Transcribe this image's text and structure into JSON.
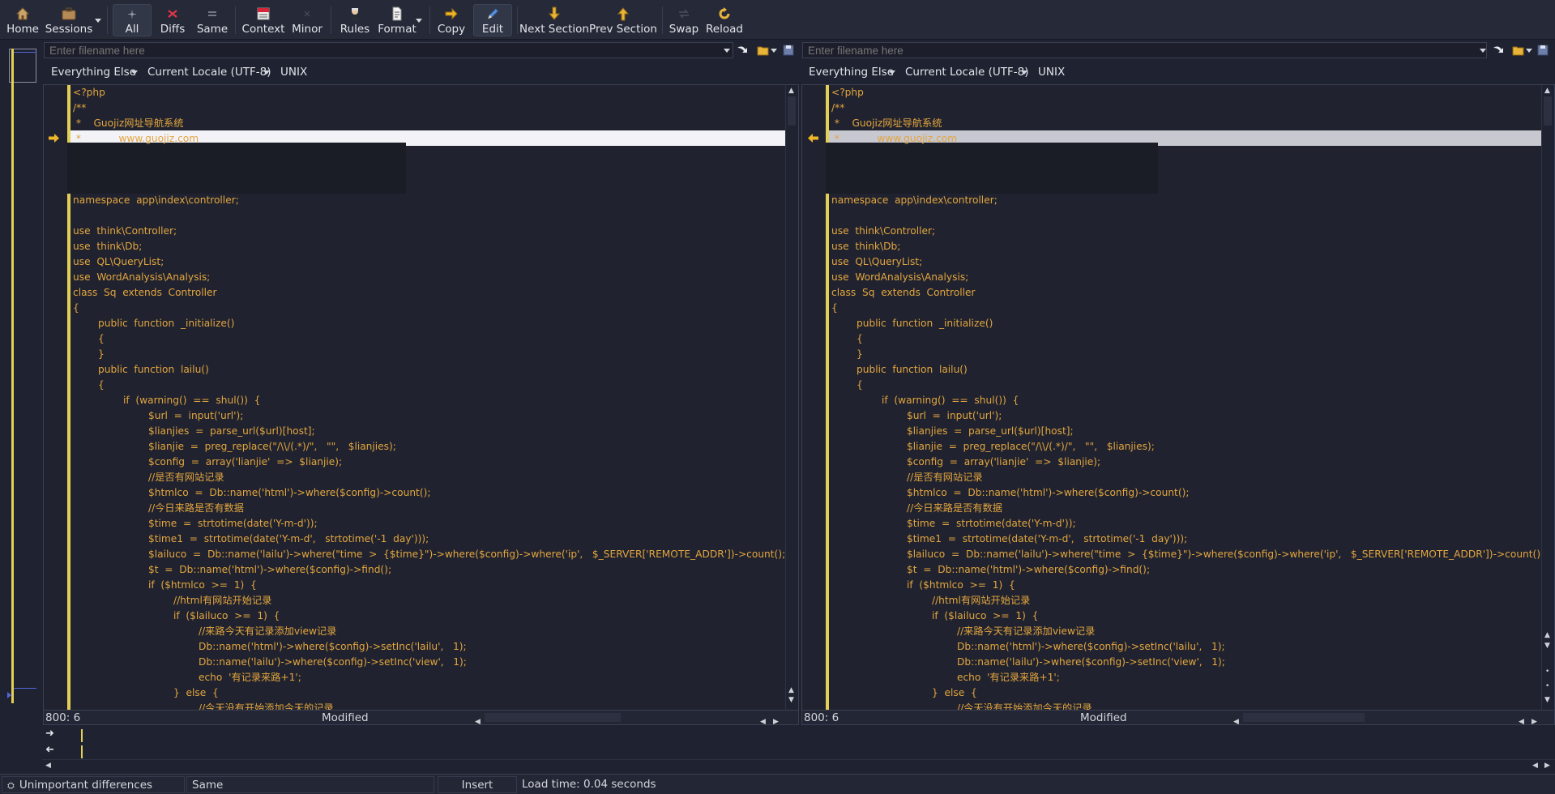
{
  "colors": {
    "background": "#1f2230",
    "code_text": "#e3a53f",
    "diff_marker": "#e3cf55",
    "left_highlight": "#f2f2f7",
    "right_highlight": "#c7c8d0"
  },
  "toolbar": {
    "home": "Home",
    "sessions": "Sessions",
    "all": "All",
    "diffs": "Diffs",
    "same": "Same",
    "context": "Context",
    "minor": "Minor",
    "rules": "Rules",
    "format": "Format",
    "copy": "Copy",
    "edit": "Edit",
    "next_section": "Next Section",
    "prev_section": "Prev Section",
    "swap": "Swap",
    "reload": "Reload"
  },
  "left": {
    "filename_placeholder": "Enter filename here",
    "file_type": "Everything Else",
    "encoding": "Current Locale (UTF-8)",
    "line_endings": "UNIX",
    "position": "800: 6",
    "modified": "Modified"
  },
  "right": {
    "filename_placeholder": "Enter filename here",
    "file_type": "Everything Else",
    "encoding": "Current Locale (UTF-8)",
    "line_endings": "UNIX",
    "position": "800: 6",
    "modified": "Modified"
  },
  "code": {
    "header": [
      "<?php",
      "/**",
      " *    Guojiz网址导航系统",
      " *            www.guojiz.com"
    ],
    "body": [
      "namespace  app\\index\\controller;",
      "",
      "use  think\\Controller;",
      "use  think\\Db;",
      "use  QL\\QueryList;",
      "use  WordAnalysis\\Analysis;",
      "class  Sq  extends  Controller",
      "{",
      "        public  function  _initialize()",
      "        {",
      "        }",
      "        public  function  lailu()",
      "        {",
      "                if  (warning()  ==  shul())  {",
      "                        $url  =  input('url');",
      "                        $lianjies  =  parse_url($url)[host];",
      "                        $lianjie  =  preg_replace(\"/\\\\/(.*)/\",   \"\",   $lianjies);",
      "                        $config  =  array('lianjie'  =>  $lianjie);",
      "                        //是否有网站记录",
      "                        $htmlco  =  Db::name('html')->where($config)->count();",
      "                        //今日来路是否有数据",
      "                        $time  =  strtotime(date('Y-m-d'));",
      "                        $time1  =  strtotime(date('Y-m-d',   strtotime('-1  day')));",
      "                        $lailuco  =  Db::name('lailu')->where(\"time  >  {$time}\")->where($config)->where('ip',   $_SERVER['REMOTE_ADDR'])->count();",
      "                        $t  =  Db::name('html')->where($config)->find();",
      "                        if  ($htmlco  >=  1)  {",
      "                                //html有网站开始记录",
      "                                if  ($lailuco  >=  1)  {",
      "                                        //来路今天有记录添加view记录",
      "                                        Db::name('html')->where($config)->setInc('lailu',   1);",
      "                                        Db::name('lailu')->where($config)->setInc('view',   1);",
      "                                        echo  '有记录来路+1';",
      "                                }  else  {",
      "                                        //今天没有开始添加今天的记录"
    ]
  },
  "status": {
    "unimportant": "Unimportant differences",
    "same": "Same",
    "insert": "Insert",
    "load_time": "Load time: 0.04 seconds"
  }
}
